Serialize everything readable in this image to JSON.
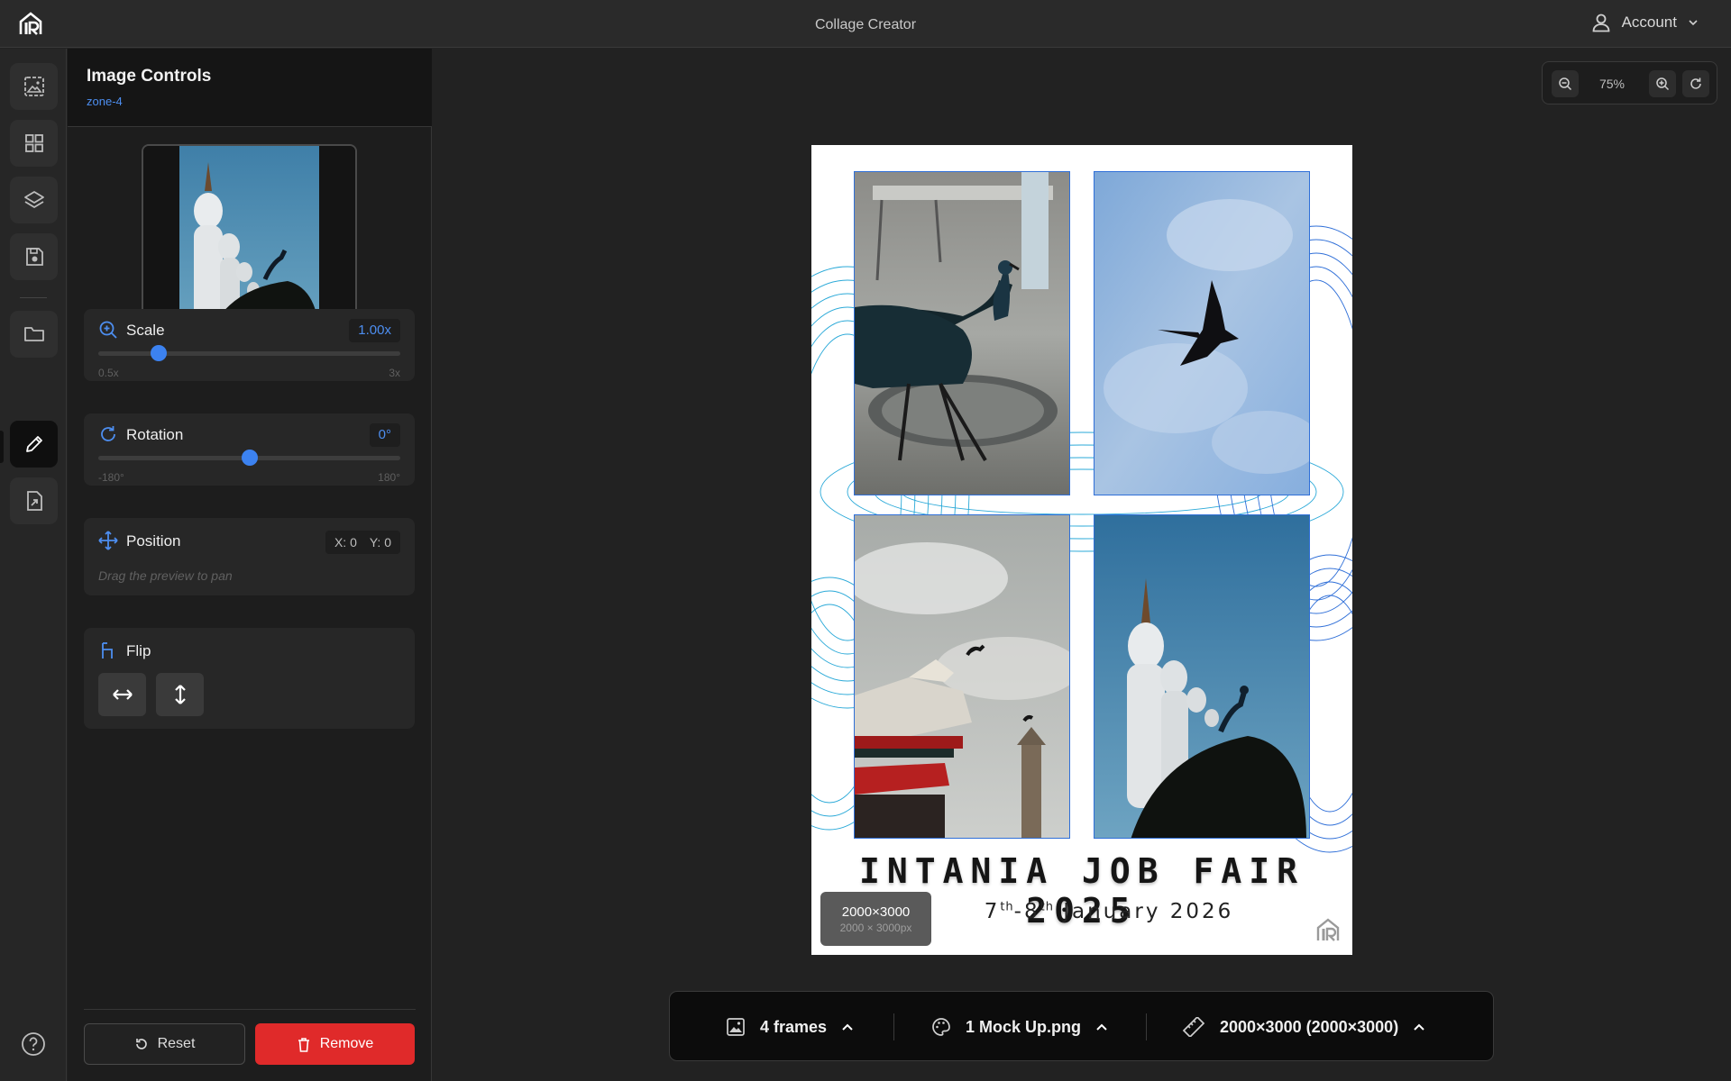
{
  "app": {
    "title": "Collage Creator",
    "account_label": "Account"
  },
  "rail": {
    "items": [
      {
        "name": "image-frame-icon"
      },
      {
        "name": "grid-layout-icon"
      },
      {
        "name": "layers-icon"
      },
      {
        "name": "save-icon"
      },
      {
        "name": "folder-icon"
      },
      {
        "name": "edit-pencil-icon",
        "active": true
      },
      {
        "name": "export-file-icon"
      }
    ],
    "help_icon": "help-circle-icon"
  },
  "panel": {
    "title": "Image Controls",
    "zone": "zone-4",
    "scale": {
      "label": "Scale",
      "value": "1.00x",
      "min": "0.5x",
      "max": "3x",
      "fraction": 0.2
    },
    "rotation": {
      "label": "Rotation",
      "value": "0°",
      "min": "-180°",
      "max": "180°",
      "fraction": 0.5
    },
    "position": {
      "label": "Position",
      "x": "X: 0",
      "y": "Y: 0",
      "hint": "Drag the preview to pan"
    },
    "flip": {
      "label": "Flip"
    },
    "reset_label": "Reset",
    "remove_label": "Remove"
  },
  "canvas": {
    "zoom": "75%",
    "poster_title": "INTANIA JOB FAIR 2025",
    "date": {
      "day1": "7",
      "sup1": "th",
      "sep": "-8",
      "sup2": "th",
      "rest": " January 2026"
    },
    "size_chip": {
      "main": "2000×3000",
      "sub": "2000 × 3000px"
    }
  },
  "bottom_bar": {
    "frames": "4 frames",
    "background": "1 Mock Up.png",
    "dimensions": "2000×3000 (2000×3000)"
  },
  "colors": {
    "accent": "#3c82f0",
    "danger": "#e02a2a",
    "panel": "#1d1d1d",
    "canvas_bg": "#222222"
  }
}
